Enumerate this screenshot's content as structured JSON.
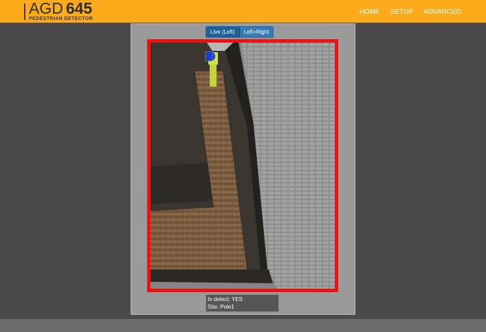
{
  "header": {
    "brand": "AGD",
    "model": "645",
    "subtitle": "PEDESTRIAN DETECTOR"
  },
  "nav": {
    "items": [
      {
        "label": "HOME"
      },
      {
        "label": "SETUP"
      },
      {
        "label": "ADVANCED"
      }
    ]
  },
  "view_modes": {
    "live_left": "Live (Left)",
    "left_right": "Left+Right",
    "selected": "Live (Left)"
  },
  "status": {
    "detect": "In detect: YES",
    "site": "Site: Pole1"
  },
  "colors": {
    "header_bg": "#fbaa1a",
    "page_bg": "#4a4a4a",
    "detection_zone": "#ee1111",
    "button_bg": "#1f5f99"
  }
}
